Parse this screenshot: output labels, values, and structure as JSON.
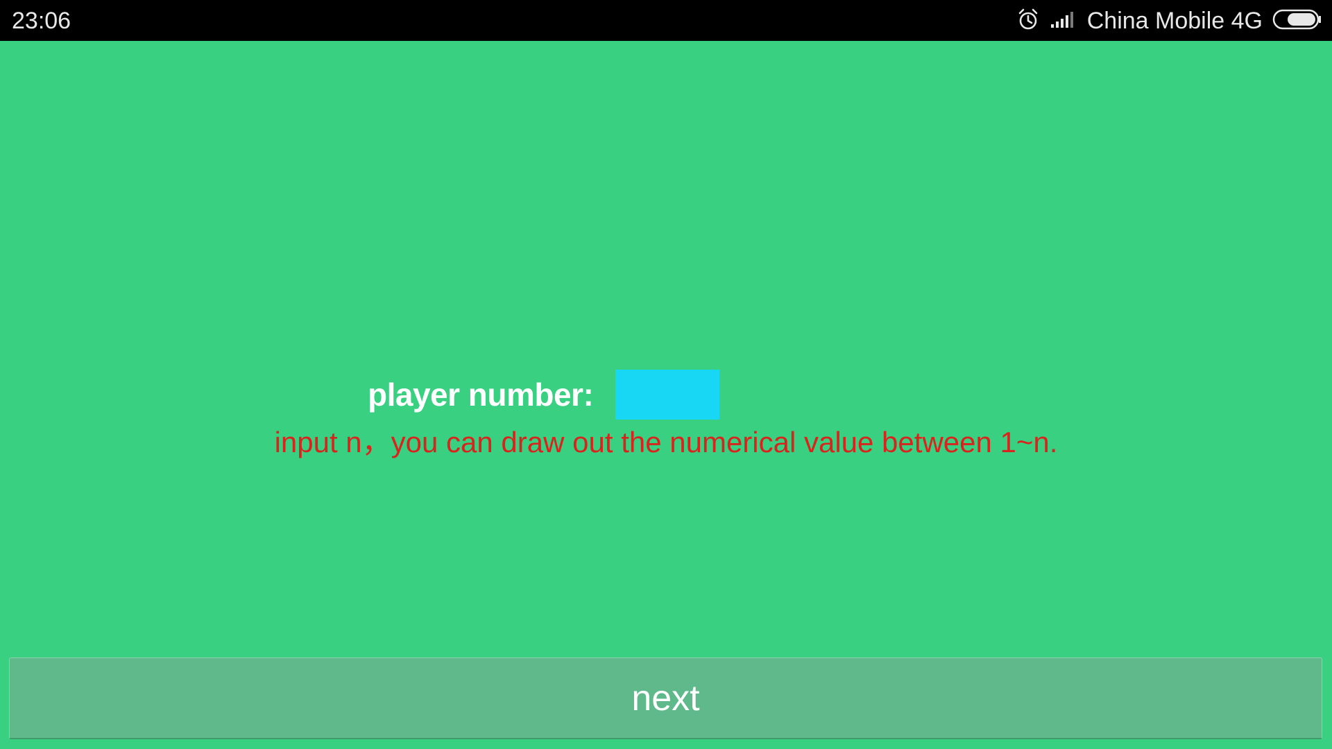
{
  "status_bar": {
    "time": "23:06",
    "carrier": "China Mobile 4G",
    "icons": [
      "alarm-icon",
      "signal-icon",
      "battery-icon"
    ]
  },
  "form": {
    "player_label": "player number:",
    "player_value": "",
    "hint": "input n，you can draw out the numerical value between 1~n."
  },
  "actions": {
    "next_label": "next"
  },
  "colors": {
    "background": "#39d082",
    "status_bar": "#000000",
    "input_fill": "#17d7f5",
    "hint_text": "#d8241c",
    "button_fill": "#5fb98b"
  }
}
